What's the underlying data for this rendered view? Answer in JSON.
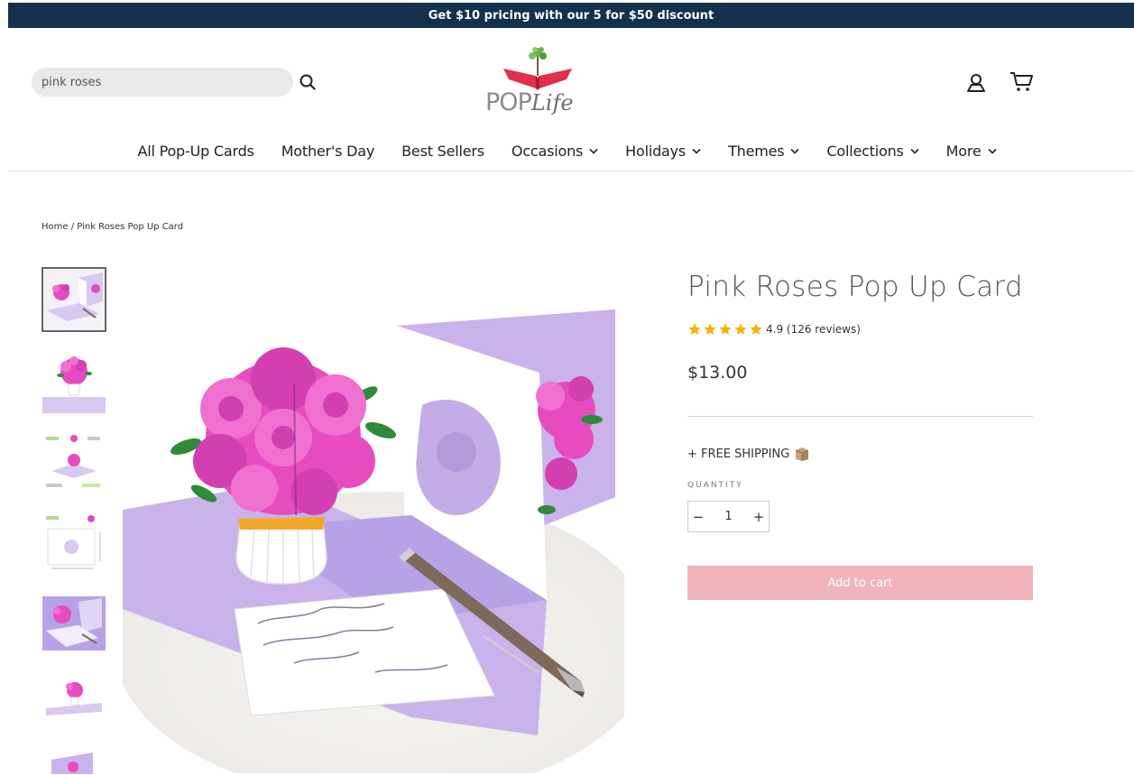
{
  "announcement": {
    "text": "Get $10 pricing with our 5 for $50 discount"
  },
  "header": {
    "search": {
      "value": "pink roses",
      "placeholder": "pink roses"
    },
    "logo": {
      "pop": "POP",
      "life": "Life"
    }
  },
  "nav": {
    "items": [
      {
        "label": "All Pop-Up Cards",
        "dropdown": false
      },
      {
        "label": "Mother's Day",
        "dropdown": false
      },
      {
        "label": "Best Sellers",
        "dropdown": false
      },
      {
        "label": "Occasions",
        "dropdown": true
      },
      {
        "label": "Holidays",
        "dropdown": true
      },
      {
        "label": "Themes",
        "dropdown": true
      },
      {
        "label": "Collections",
        "dropdown": true
      },
      {
        "label": "More",
        "dropdown": true
      }
    ]
  },
  "breadcrumb": {
    "home": "Home",
    "separator": " / ",
    "current": "Pink Roses Pop Up Card"
  },
  "product": {
    "title": "Pink Roses Pop Up Card",
    "rating": {
      "value": 4.9,
      "text": "4.9 (126 reviews)",
      "stars": 5
    },
    "price": "$13.00",
    "shipping": "+ FREE SHIPPING",
    "quantity_label": "QUANTITY",
    "quantity": "1",
    "minus": "−",
    "plus": "+",
    "add_to_cart": "Add to cart"
  },
  "colors": {
    "announce_bg": "#14304d",
    "star": "#f5b400",
    "add_to_cart_bg": "#f1b3bc",
    "logo_red": "#e0304a",
    "rose_pink": "#e64cc0",
    "card_lavender": "#c9b3ea"
  },
  "icons": {
    "search": "search-icon",
    "account": "account-icon",
    "cart": "cart-icon",
    "chevron": "chevron-down-icon",
    "box": "box-icon"
  }
}
